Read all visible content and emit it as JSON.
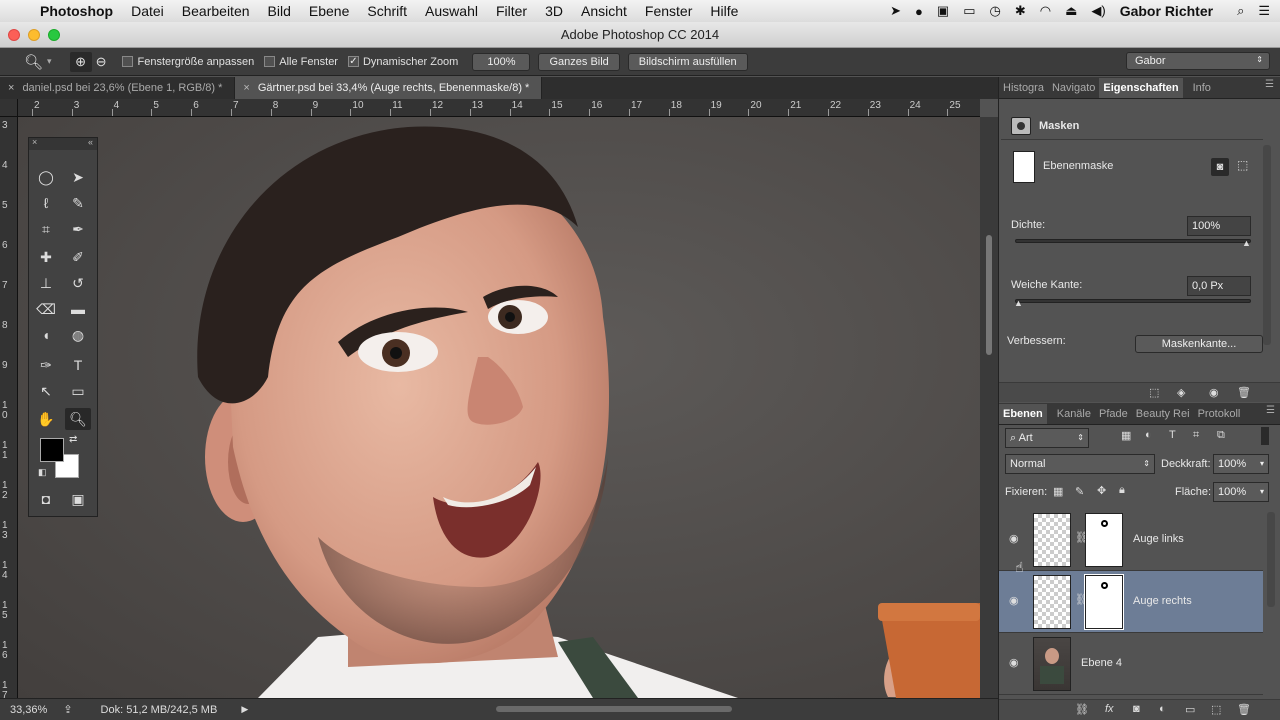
{
  "menubar": {
    "app_name": "Photoshop",
    "items": [
      "Datei",
      "Bearbeiten",
      "Bild",
      "Ebene",
      "Schrift",
      "Auswahl",
      "Filter",
      "3D",
      "Ansicht",
      "Fenster",
      "Hilfe"
    ],
    "user": "Gabor Richter"
  },
  "window": {
    "title": "Adobe Photoshop CC 2014"
  },
  "options_bar": {
    "check_fit": "Fenstergröße anpassen",
    "check_all": "Alle Fenster",
    "check_dynamic": "Dynamischer Zoom",
    "zoom_btn": "100%",
    "whole_btn": "Ganzes Bild",
    "fill_btn": "Bildschirm ausfüllen",
    "workspace": "Gabor"
  },
  "doc_tabs": [
    {
      "label": "daniel.psd bei 23,6% (Ebene 1, RGB/8) *"
    },
    {
      "label": "Gärtner.psd bei 33,4% (Auge rechts, Ebenenmaske/8) *"
    }
  ],
  "ruler_top": [
    "2",
    "3",
    "4",
    "5",
    "6",
    "7",
    "8",
    "9",
    "10",
    "11",
    "12",
    "13",
    "14",
    "15",
    "16",
    "17",
    "18",
    "19",
    "20",
    "21",
    "22",
    "23",
    "24",
    "25"
  ],
  "ruler_left": [
    "3",
    "4",
    "5",
    "6",
    "7",
    "8",
    "9",
    "1 0",
    "1 1",
    "1 2",
    "1 3",
    "1 4",
    "1 5",
    "1 6",
    "1 7"
  ],
  "status": {
    "zoom": "33,36%",
    "doc": "Dok: 51,2 MB/242,5 MB"
  },
  "properties_panel": {
    "tabs": [
      "Histogra",
      "Navigato",
      "Eigenschaften",
      "Info"
    ],
    "section": "Masken",
    "mask_label": "Ebenenmaske",
    "density_label": "Dichte:",
    "density_value": "100%",
    "density_level": 1.0,
    "feather_label": "Weiche Kante:",
    "feather_value": "0,0 Px",
    "feather_level": 0.0,
    "refine_label": "Verbessern:",
    "refine_btn": "Maskenkante..."
  },
  "layers_panel": {
    "tabs": [
      "Ebenen",
      "Kanäle",
      "Pfade",
      "Beauty Rei",
      "Protokoll"
    ],
    "filter": "Art",
    "blend_mode": "Normal",
    "opacity_label": "Deckkraft:",
    "opacity_value": "100%",
    "lock_label": "Fixieren:",
    "fill_label": "Fläche:",
    "fill_value": "100%",
    "layers": [
      {
        "name": "Auge links"
      },
      {
        "name": "Auge rechts"
      },
      {
        "name": "Ebene 4"
      }
    ]
  },
  "colors": {
    "selection": "#6d7d96",
    "panel": "#535353"
  }
}
